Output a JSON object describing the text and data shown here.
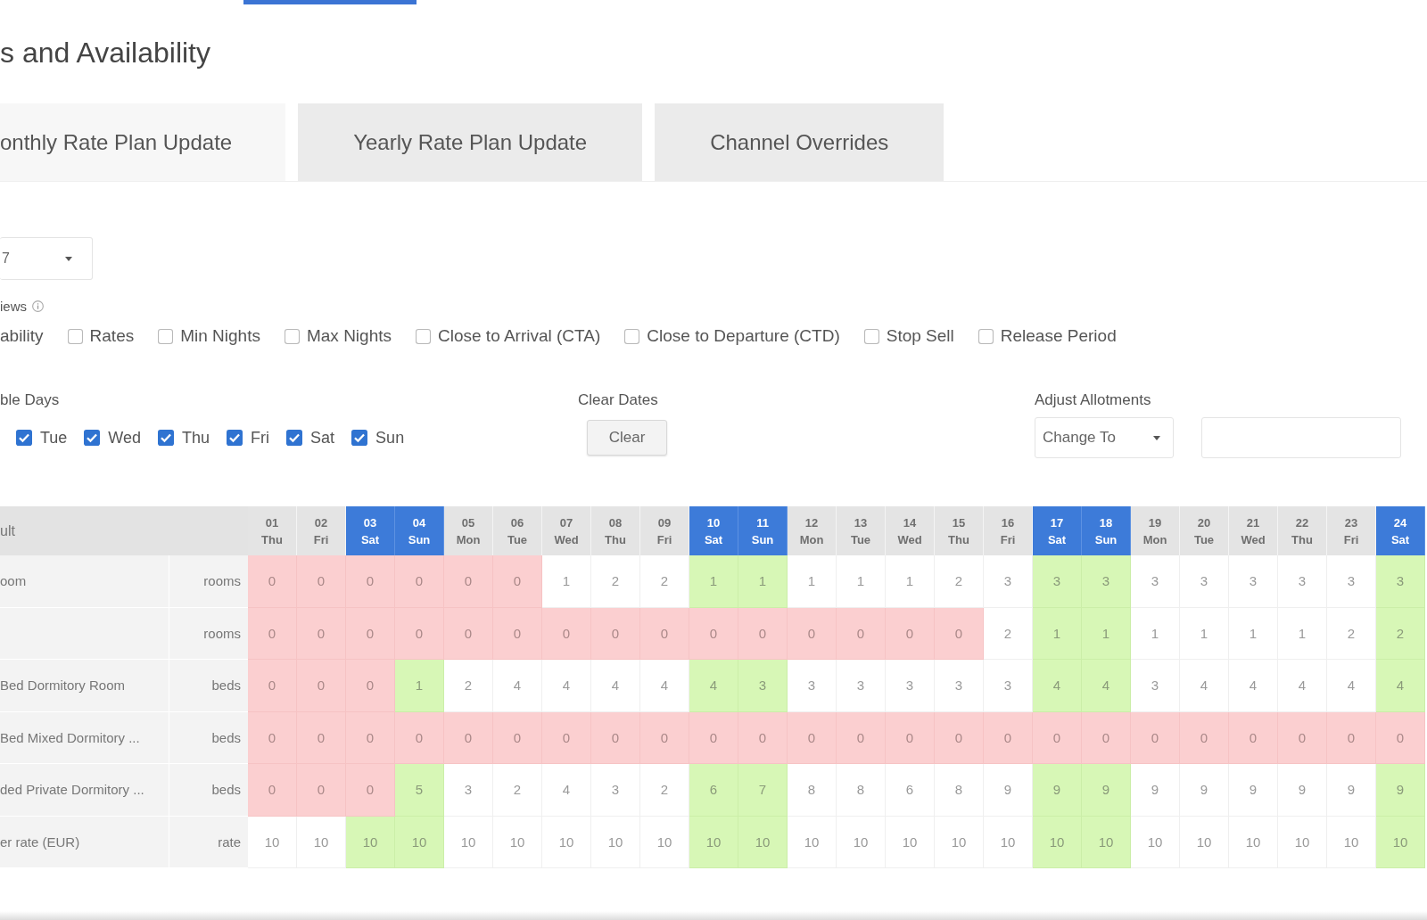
{
  "page": {
    "title": "s and Availability"
  },
  "tabs": [
    {
      "label": "onthly Rate Plan Update",
      "selected": true
    },
    {
      "label": "Yearly Rate Plan Update",
      "selected": false
    },
    {
      "label": "Channel Overrides",
      "selected": false
    }
  ],
  "rate_plan_select": {
    "value": "7"
  },
  "views": {
    "label": "iews",
    "cut_option": "ability",
    "options": [
      {
        "label": "Rates",
        "checked": false
      },
      {
        "label": "Min Nights",
        "checked": false
      },
      {
        "label": "Max Nights",
        "checked": false
      },
      {
        "label": "Close to Arrival (CTA)",
        "checked": false
      },
      {
        "label": "Close to Departure (CTD)",
        "checked": false
      },
      {
        "label": "Stop Sell",
        "checked": false
      },
      {
        "label": "Release Period",
        "checked": false
      }
    ]
  },
  "days": {
    "label": "ble Days",
    "items": [
      {
        "label": "Tue",
        "checked": true
      },
      {
        "label": "Wed",
        "checked": true
      },
      {
        "label": "Thu",
        "checked": true
      },
      {
        "label": "Fri",
        "checked": true
      },
      {
        "label": "Sat",
        "checked": true
      },
      {
        "label": "Sun",
        "checked": true
      }
    ]
  },
  "clear_dates": {
    "label": "Clear Dates",
    "button": "Clear"
  },
  "allotments": {
    "label": "Adjust Allotments",
    "mode": "Change To"
  },
  "grid": {
    "corner": "ult",
    "columns": [
      {
        "day": "01",
        "weekday": "Thu",
        "weekend": false
      },
      {
        "day": "02",
        "weekday": "Fri",
        "weekend": false
      },
      {
        "day": "03",
        "weekday": "Sat",
        "weekend": true
      },
      {
        "day": "04",
        "weekday": "Sun",
        "weekend": true
      },
      {
        "day": "05",
        "weekday": "Mon",
        "weekend": false
      },
      {
        "day": "06",
        "weekday": "Tue",
        "weekend": false
      },
      {
        "day": "07",
        "weekday": "Wed",
        "weekend": false
      },
      {
        "day": "08",
        "weekday": "Thu",
        "weekend": false
      },
      {
        "day": "09",
        "weekday": "Fri",
        "weekend": false
      },
      {
        "day": "10",
        "weekday": "Sat",
        "weekend": true
      },
      {
        "day": "11",
        "weekday": "Sun",
        "weekend": true
      },
      {
        "day": "12",
        "weekday": "Mon",
        "weekend": false
      },
      {
        "day": "13",
        "weekday": "Tue",
        "weekend": false
      },
      {
        "day": "14",
        "weekday": "Wed",
        "weekend": false
      },
      {
        "day": "15",
        "weekday": "Thu",
        "weekend": false
      },
      {
        "day": "16",
        "weekday": "Fri",
        "weekend": false
      },
      {
        "day": "17",
        "weekday": "Sat",
        "weekend": true
      },
      {
        "day": "18",
        "weekday": "Sun",
        "weekend": true
      },
      {
        "day": "19",
        "weekday": "Mon",
        "weekend": false
      },
      {
        "day": "20",
        "weekday": "Tue",
        "weekend": false
      },
      {
        "day": "21",
        "weekday": "Wed",
        "weekend": false
      },
      {
        "day": "22",
        "weekday": "Thu",
        "weekend": false
      },
      {
        "day": "23",
        "weekday": "Fri",
        "weekend": false
      },
      {
        "day": "24",
        "weekday": "Sat",
        "weekend": true
      }
    ],
    "rows": [
      {
        "name": "oom",
        "unit": "rooms",
        "cells": [
          {
            "value": "0",
            "closed": true
          },
          {
            "value": "0",
            "closed": true
          },
          {
            "value": "0",
            "closed": true
          },
          {
            "value": "0",
            "closed": true
          },
          {
            "value": "0",
            "closed": true
          },
          {
            "value": "0",
            "closed": true
          },
          {
            "value": "1",
            "closed": false
          },
          {
            "value": "2",
            "closed": false
          },
          {
            "value": "2",
            "closed": false
          },
          {
            "value": "1",
            "closed": false
          },
          {
            "value": "1",
            "closed": false
          },
          {
            "value": "1",
            "closed": false
          },
          {
            "value": "1",
            "closed": false
          },
          {
            "value": "1",
            "closed": false
          },
          {
            "value": "2",
            "closed": false
          },
          {
            "value": "3",
            "closed": false
          },
          {
            "value": "3",
            "closed": false
          },
          {
            "value": "3",
            "closed": false
          },
          {
            "value": "3",
            "closed": false
          },
          {
            "value": "3",
            "closed": false
          },
          {
            "value": "3",
            "closed": false
          },
          {
            "value": "3",
            "closed": false
          },
          {
            "value": "3",
            "closed": false
          },
          {
            "value": "3",
            "closed": false
          }
        ]
      },
      {
        "unit": "rooms",
        "cells": [
          {
            "value": "0",
            "closed": true
          },
          {
            "value": "0",
            "closed": true
          },
          {
            "value": "0",
            "closed": true
          },
          {
            "value": "0",
            "closed": true
          },
          {
            "value": "0",
            "closed": true
          },
          {
            "value": "0",
            "closed": true
          },
          {
            "value": "0",
            "closed": true
          },
          {
            "value": "0",
            "closed": true
          },
          {
            "value": "0",
            "closed": true
          },
          {
            "value": "0",
            "closed": true
          },
          {
            "value": "0",
            "closed": true
          },
          {
            "value": "0",
            "closed": true
          },
          {
            "value": "0",
            "closed": true
          },
          {
            "value": "0",
            "closed": true
          },
          {
            "value": "0",
            "closed": true
          },
          {
            "value": "2",
            "closed": false
          },
          {
            "value": "1",
            "closed": false
          },
          {
            "value": "1",
            "closed": false
          },
          {
            "value": "1",
            "closed": false
          },
          {
            "value": "1",
            "closed": false
          },
          {
            "value": "1",
            "closed": false
          },
          {
            "value": "1",
            "closed": false
          },
          {
            "value": "2",
            "closed": false
          },
          {
            "value": "2",
            "closed": false
          }
        ]
      },
      {
        "name": "Bed Dormitory Room",
        "unit": "beds",
        "cells": [
          {
            "value": "0",
            "closed": true
          },
          {
            "value": "0",
            "closed": true
          },
          {
            "value": "0",
            "closed": true
          },
          {
            "value": "1",
            "closed": false
          },
          {
            "value": "2",
            "closed": false
          },
          {
            "value": "4",
            "closed": false
          },
          {
            "value": "4",
            "closed": false
          },
          {
            "value": "4",
            "closed": false
          },
          {
            "value": "4",
            "closed": false
          },
          {
            "value": "4",
            "closed": false
          },
          {
            "value": "3",
            "closed": false
          },
          {
            "value": "3",
            "closed": false
          },
          {
            "value": "3",
            "closed": false
          },
          {
            "value": "3",
            "closed": false
          },
          {
            "value": "3",
            "closed": false
          },
          {
            "value": "3",
            "closed": false
          },
          {
            "value": "4",
            "closed": false
          },
          {
            "value": "4",
            "closed": false
          },
          {
            "value": "3",
            "closed": false
          },
          {
            "value": "4",
            "closed": false
          },
          {
            "value": "4",
            "closed": false
          },
          {
            "value": "4",
            "closed": false
          },
          {
            "value": "4",
            "closed": false
          },
          {
            "value": "4",
            "closed": false
          }
        ]
      },
      {
        "name": "Bed Mixed Dormitory ...",
        "unit": "beds",
        "cells": [
          {
            "value": "0",
            "closed": true
          },
          {
            "value": "0",
            "closed": true
          },
          {
            "value": "0",
            "closed": true
          },
          {
            "value": "0",
            "closed": true
          },
          {
            "value": "0",
            "closed": true
          },
          {
            "value": "0",
            "closed": true
          },
          {
            "value": "0",
            "closed": true
          },
          {
            "value": "0",
            "closed": true
          },
          {
            "value": "0",
            "closed": true
          },
          {
            "value": "0",
            "closed": true
          },
          {
            "value": "0",
            "closed": true
          },
          {
            "value": "0",
            "closed": true
          },
          {
            "value": "0",
            "closed": true
          },
          {
            "value": "0",
            "closed": true
          },
          {
            "value": "0",
            "closed": true
          },
          {
            "value": "0",
            "closed": true
          },
          {
            "value": "0",
            "closed": true
          },
          {
            "value": "0",
            "closed": true
          },
          {
            "value": "0",
            "closed": true
          },
          {
            "value": "0",
            "closed": true
          },
          {
            "value": "0",
            "closed": true
          },
          {
            "value": "0",
            "closed": true
          },
          {
            "value": "0",
            "closed": true
          },
          {
            "value": "0",
            "closed": true
          }
        ]
      },
      {
        "name": "ded Private Dormitory ...",
        "unit": "beds",
        "cells": [
          {
            "value": "0",
            "closed": true
          },
          {
            "value": "0",
            "closed": true
          },
          {
            "value": "0",
            "closed": true
          },
          {
            "value": "5",
            "closed": false
          },
          {
            "value": "3",
            "closed": false
          },
          {
            "value": "2",
            "closed": false
          },
          {
            "value": "4",
            "closed": false
          },
          {
            "value": "3",
            "closed": false
          },
          {
            "value": "2",
            "closed": false
          },
          {
            "value": "6",
            "closed": false
          },
          {
            "value": "7",
            "closed": false
          },
          {
            "value": "8",
            "closed": false
          },
          {
            "value": "8",
            "closed": false
          },
          {
            "value": "6",
            "closed": false
          },
          {
            "value": "8",
            "closed": false
          },
          {
            "value": "9",
            "closed": false
          },
          {
            "value": "9",
            "closed": false
          },
          {
            "value": "9",
            "closed": false
          },
          {
            "value": "9",
            "closed": false
          },
          {
            "value": "9",
            "closed": false
          },
          {
            "value": "9",
            "closed": false
          },
          {
            "value": "9",
            "closed": false
          },
          {
            "value": "9",
            "closed": false
          },
          {
            "value": "9",
            "closed": false
          }
        ]
      },
      {
        "name": "er rate (EUR)",
        "unit": "rate",
        "cells": [
          {
            "value": "10",
            "closed": false
          },
          {
            "value": "10",
            "closed": false
          },
          {
            "value": "10",
            "closed": false
          },
          {
            "value": "10",
            "closed": false
          },
          {
            "value": "10",
            "closed": false
          },
          {
            "value": "10",
            "closed": false
          },
          {
            "value": "10",
            "closed": false
          },
          {
            "value": "10",
            "closed": false
          },
          {
            "value": "10",
            "closed": false
          },
          {
            "value": "10",
            "closed": false
          },
          {
            "value": "10",
            "closed": false
          },
          {
            "value": "10",
            "closed": false
          },
          {
            "value": "10",
            "closed": false
          },
          {
            "value": "10",
            "closed": false
          },
          {
            "value": "10",
            "closed": false
          },
          {
            "value": "10",
            "closed": false
          },
          {
            "value": "10",
            "closed": false
          },
          {
            "value": "10",
            "closed": false
          },
          {
            "value": "10",
            "closed": false
          },
          {
            "value": "10",
            "closed": false
          },
          {
            "value": "10",
            "closed": false
          },
          {
            "value": "10",
            "closed": false
          },
          {
            "value": "10",
            "closed": false
          },
          {
            "value": "10",
            "closed": false
          }
        ]
      }
    ]
  }
}
